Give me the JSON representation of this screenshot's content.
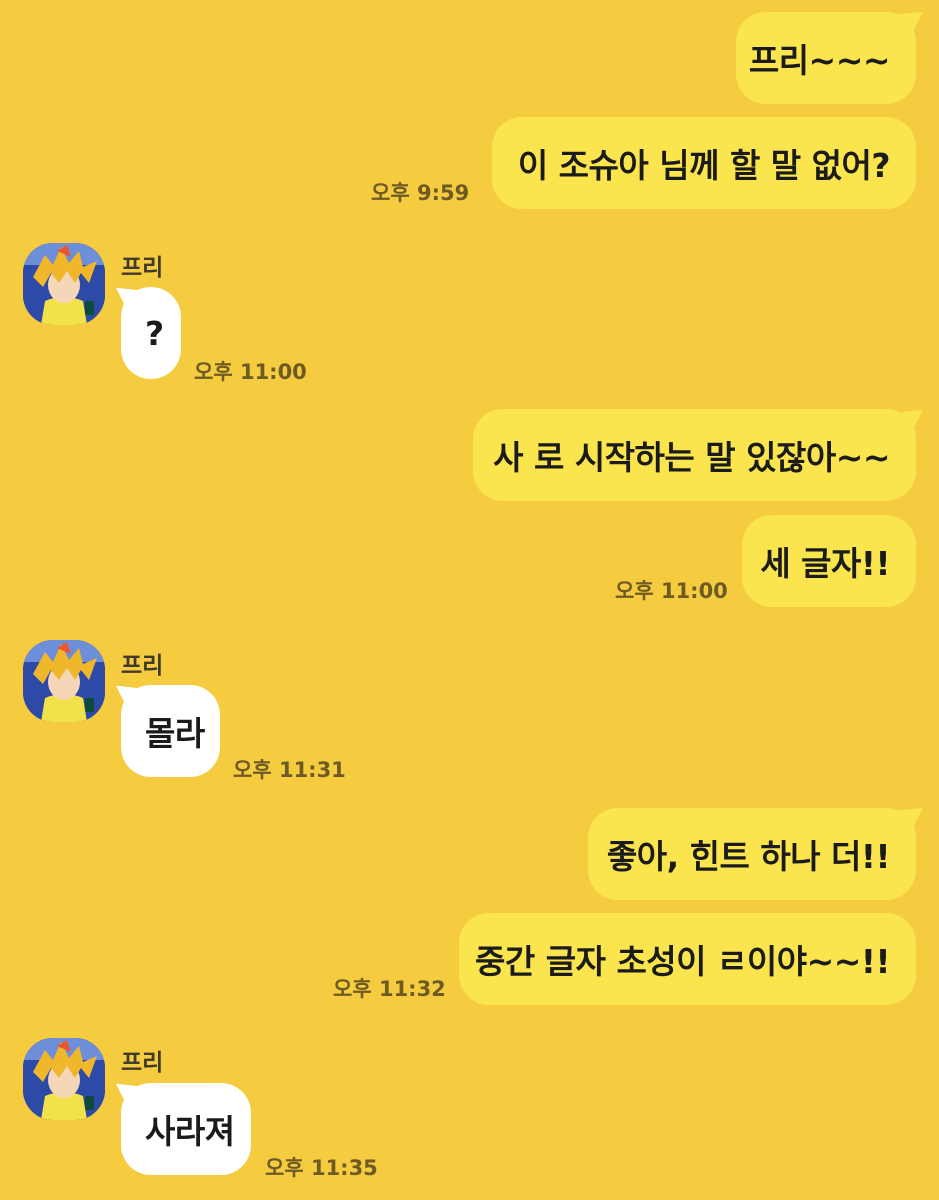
{
  "colors": {
    "background": "#f5cc3f",
    "my_bubble": "#fae54f",
    "their_bubble": "#ffffff",
    "timestamp": "#6e5a22"
  },
  "contact": {
    "name": "프리",
    "avatar_icon": "anime-character-avatar"
  },
  "messages": {
    "m1": {
      "text": "프리~~~"
    },
    "m2": {
      "text": "이 조슈아 님께 할 말 없어?",
      "time": "오후 9:59"
    },
    "m3": {
      "sender": "프리",
      "text": "?",
      "time": "오후 11:00"
    },
    "m4": {
      "text": "사 로 시작하는 말 있잖아~~"
    },
    "m5": {
      "text": "세 글자!!",
      "time": "오후 11:00"
    },
    "m6": {
      "sender": "프리",
      "text": "몰라",
      "time": "오후 11:31"
    },
    "m7": {
      "text": "좋아, 힌트 하나 더!!"
    },
    "m8": {
      "text": "중간 글자 초성이 ㄹ이야~~!!",
      "time": "오후 11:32"
    },
    "m9": {
      "sender": "프리",
      "text": "사라져",
      "time": "오후 11:35"
    }
  }
}
